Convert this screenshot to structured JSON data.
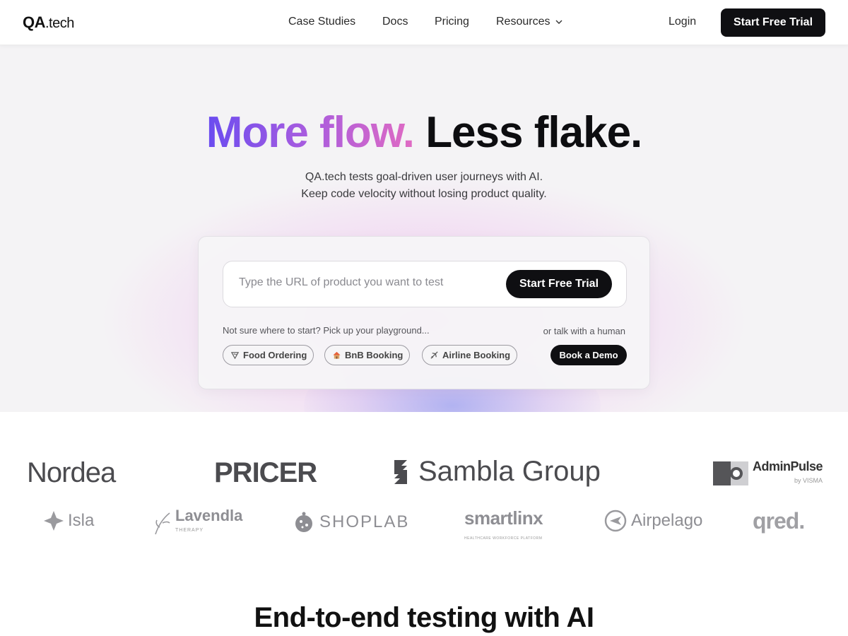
{
  "nav": {
    "logo_bold": "QA",
    "logo_rest": ".tech",
    "links": [
      "Case Studies",
      "Docs",
      "Pricing",
      "Resources"
    ],
    "login": "Login",
    "cta": "Start Free Trial"
  },
  "hero": {
    "headline_grad": "More flow.",
    "headline_dark": "Less flake.",
    "sub1": "QA.tech tests goal-driven user journeys with AI.",
    "sub2": "Keep code velocity without losing product quality.",
    "url_placeholder": "Type the URL of product you want to test",
    "url_cta": "Start Free Trial",
    "hint": "Not sure where to start? Pick up your playground...",
    "talk": "or talk with a human",
    "chips": [
      "Food Ordering",
      "BnB Booking",
      "Airline Booking"
    ],
    "demo": "Book a Demo"
  },
  "logos": {
    "row1": [
      "Nordea",
      "PRICER",
      "Sambla Group",
      "AdminPulse"
    ],
    "adminpulse_sub": "by VISMA",
    "row2": [
      "Isla",
      "Lavendla",
      "SHOPLAB",
      "smartlinx",
      "Airpelago",
      "qred."
    ],
    "lavendla_sub": "THERAPY",
    "smartlinx_sub": "HEALTHCARE WORKFORCE PLATFORM"
  },
  "section": {
    "title": "End-to-end testing with AI"
  },
  "colors": {
    "accent_start": "#6a4cf0",
    "accent_end": "#e06bc3",
    "button": "#0f0f12"
  }
}
